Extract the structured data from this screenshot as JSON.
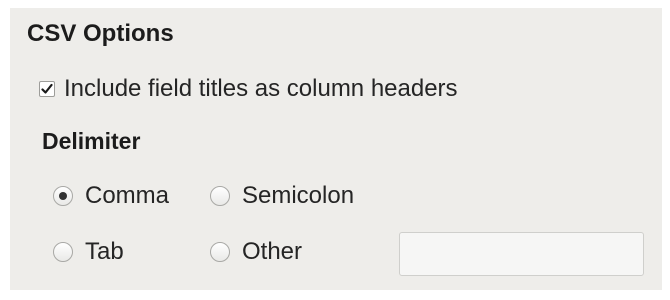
{
  "section": {
    "title": "CSV Options"
  },
  "include_headers": {
    "label": "Include field titles as column headers",
    "checked": true
  },
  "delimiter": {
    "title": "Delimiter",
    "options": [
      {
        "label": "Comma",
        "selected": true
      },
      {
        "label": "Semicolon",
        "selected": false
      },
      {
        "label": "Tab",
        "selected": false
      },
      {
        "label": "Other",
        "selected": false
      }
    ],
    "other_value": ""
  }
}
